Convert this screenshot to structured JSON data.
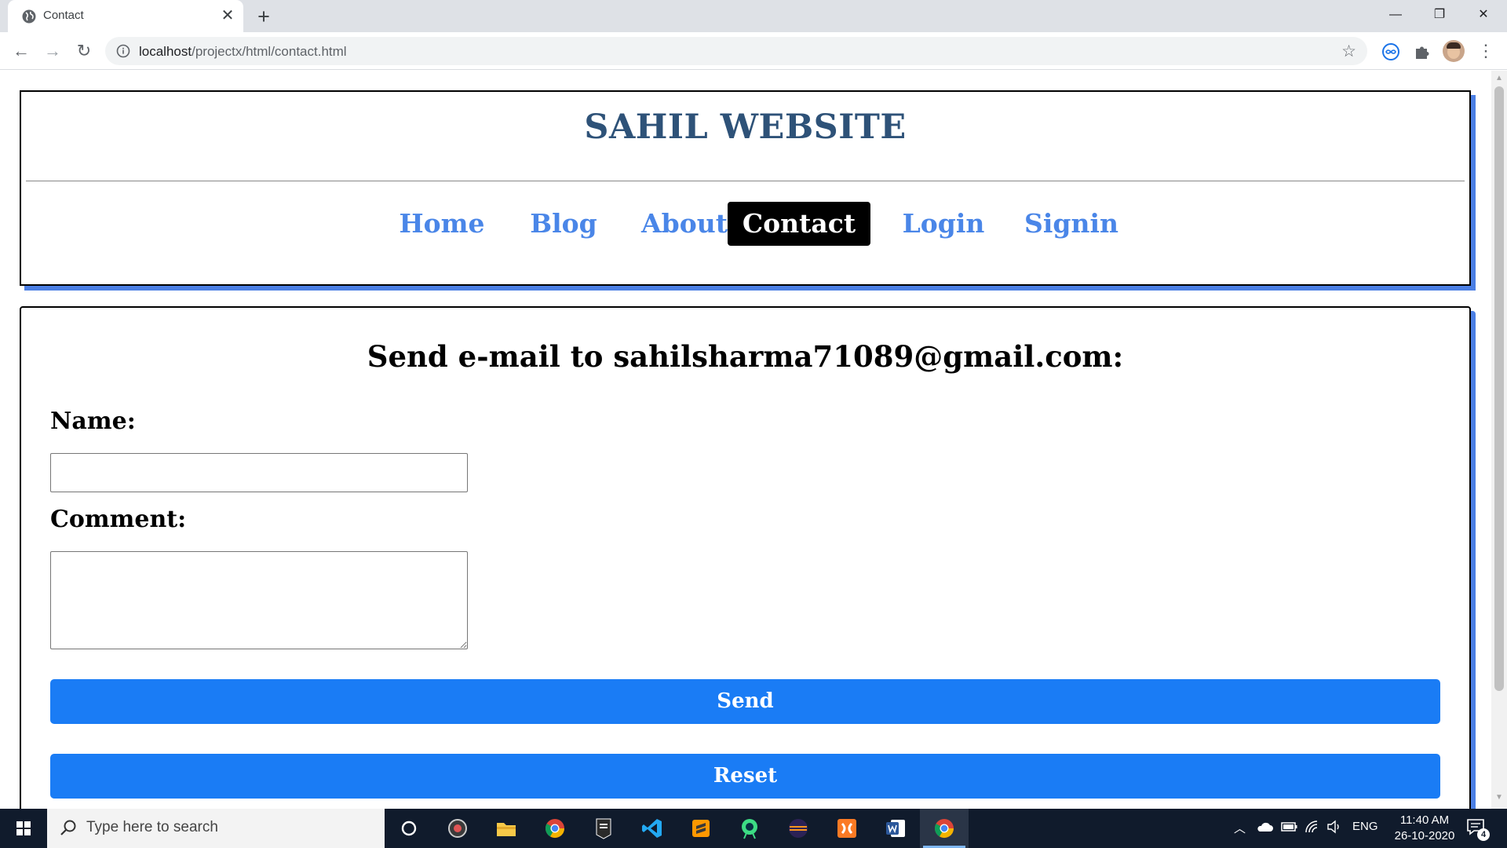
{
  "browser": {
    "tab_title": "Contact",
    "url_host": "localhost",
    "url_path": "/projectx/html/contact.html"
  },
  "site": {
    "title": "SAHIL WEBSITE",
    "nav": [
      {
        "label": "Home",
        "active": false
      },
      {
        "label": "Blog",
        "active": false
      },
      {
        "label": "About",
        "active": false
      },
      {
        "label": "Contact",
        "active": true
      },
      {
        "label": "Login",
        "active": false
      },
      {
        "label": "Signin",
        "active": false
      }
    ]
  },
  "form": {
    "heading": "Send e-mail to sahilsharma71089@gmail.com:",
    "name_label": "Name:",
    "name_value": "",
    "comment_label": "Comment:",
    "comment_value": "",
    "send_label": "Send",
    "reset_label": "Reset"
  },
  "colors": {
    "title": "#2e5278",
    "nav_link": "#4a86e8",
    "nav_active_bg": "#000000",
    "box_shadow": "#4b7fe4",
    "button": "#1a7cf5"
  },
  "taskbar": {
    "search_placeholder": "Type here to search",
    "apps": [
      "cortana-icon",
      "obs-icon",
      "file-explorer-icon",
      "chrome-icon",
      "epic-games-icon",
      "vscode-icon",
      "sublime-text-icon",
      "android-studio-icon",
      "eclipse-icon",
      "xampp-icon",
      "word-icon",
      "chrome-active-icon"
    ],
    "language": "ENG",
    "time": "11:40 AM",
    "date": "26-10-2020",
    "notification_count": "4"
  }
}
